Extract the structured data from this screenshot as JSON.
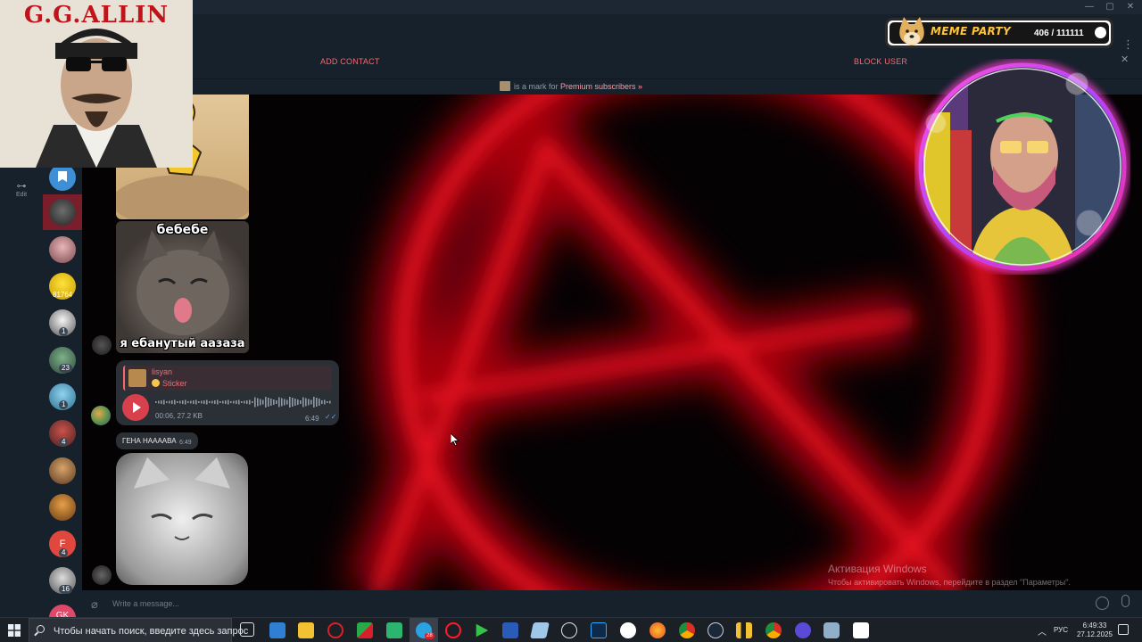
{
  "header": {
    "add_contact": "ADD CONTACT",
    "block_user": "BLOCK USER",
    "premium_prefix": "is a mark for",
    "premium_link": "Premium subscribers »",
    "close_glyph": "✕",
    "more_glyph": "⋮"
  },
  "window_controls": {
    "minimize": "—",
    "maximize": "▢",
    "close": "✕"
  },
  "folders": {
    "edit_label": "Edit",
    "edit_icon": "sliders-icon"
  },
  "chat_list": {
    "badges": [
      {
        "text": "81764"
      },
      {
        "text": "1"
      },
      {
        "text": "23"
      },
      {
        "text": "1"
      },
      {
        "text": "4"
      },
      {
        "text": "4"
      },
      {
        "text": "16"
      }
    ],
    "letter_avatars": [
      "F",
      "GK"
    ]
  },
  "messages": {
    "sticker_caption_top": "бебебе",
    "sticker_caption_bottom": "я ебанутый аазаза",
    "voice": {
      "reply_name": "lisyan",
      "reply_sub": "Sticker",
      "meta": "00:06, 27.2 KB",
      "time": "6:49",
      "check": "✓✓"
    },
    "text": {
      "body": "ГЕНА НААААВА",
      "time": "6:49"
    }
  },
  "compose": {
    "placeholder": "Write a message..."
  },
  "watermark": {
    "title": "Активация Windows",
    "subtitle": "Чтобы активировать Windows, перейдите в раздел \"Параметры\"."
  },
  "overlays": {
    "left_title": "G.G.ALLIN",
    "meme_title": "MEME PARTY",
    "meme_count": "406 / 111111"
  },
  "taskbar": {
    "search_placeholder": "Чтобы начать поиск, введите здесь запрос",
    "lang": "РУС",
    "time": "6:49:33",
    "date": "27.12.2025",
    "telegram_badge": "28",
    "tray_chevron": "︿"
  },
  "colors": {
    "accent_red": "#ef6b73",
    "panel": "#17212b",
    "bubble": "#2b2f36",
    "play": "#d9404e"
  }
}
